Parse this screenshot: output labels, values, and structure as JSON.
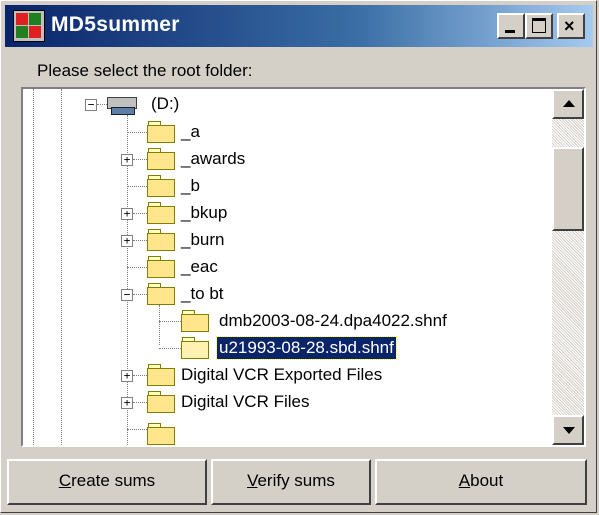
{
  "window": {
    "title": "MD5summer",
    "controls": {
      "minimize": "minimize",
      "maximize": "maximize",
      "close": "×"
    }
  },
  "prompt": "Please select the root folder:",
  "tree": {
    "drive_label": "(D:)",
    "items": [
      {
        "label": "_a",
        "expander": ""
      },
      {
        "label": "_awards",
        "expander": "+"
      },
      {
        "label": "_b",
        "expander": ""
      },
      {
        "label": "_bkup",
        "expander": "+"
      },
      {
        "label": "_burn",
        "expander": "+"
      },
      {
        "label": "_eac",
        "expander": ""
      },
      {
        "label": "_to bt",
        "expander": "−"
      },
      {
        "label": "dmb2003-08-24.dpa4022.shnf",
        "expander": ""
      },
      {
        "label": "u21993-08-28.sbd.shnf",
        "expander": "",
        "selected": true
      },
      {
        "label": "Digital VCR Exported Files",
        "expander": "+"
      },
      {
        "label": "Digital VCR Files",
        "expander": "+"
      }
    ]
  },
  "buttons": {
    "create": {
      "mnemonic": "C",
      "rest": "reate sums"
    },
    "verify": {
      "mnemonic": "V",
      "rest": "erify sums"
    },
    "about": {
      "mnemonic": "A",
      "rest": "bout"
    }
  }
}
